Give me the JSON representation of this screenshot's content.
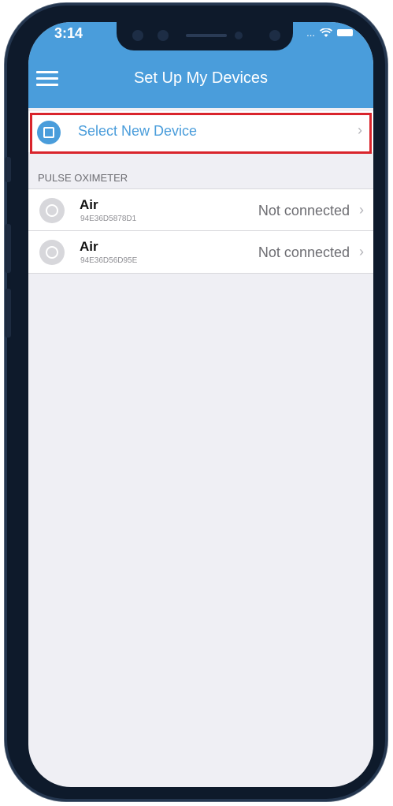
{
  "status_bar": {
    "time": "3:14",
    "signal_text": "..."
  },
  "header": {
    "title": "Set Up My Devices",
    "menu_icon": "hamburger-menu-icon",
    "background_color": "#4a9ddb"
  },
  "select_device": {
    "label": "Select New Device",
    "icon": "device-chip-icon",
    "chevron": "›",
    "highlight_color": "#d9242c"
  },
  "section": {
    "title": "PULSE OXIMETER"
  },
  "devices": [
    {
      "name": "Air",
      "id": "94E36D5878D1",
      "status": "Not connected",
      "chevron": "›"
    },
    {
      "name": "Air",
      "id": "94E36D56D95E",
      "status": "Not connected",
      "chevron": "›"
    }
  ]
}
